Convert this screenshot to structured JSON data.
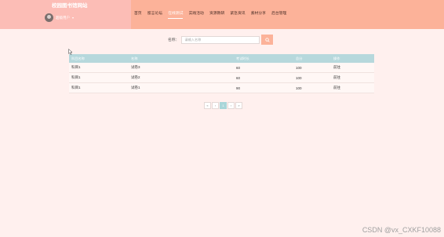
{
  "header": {
    "site_title": "校园图书馆网站",
    "username": "超级用户",
    "user_caret": "▾",
    "nav": [
      {
        "label": "首页"
      },
      {
        "label": "留言论坛"
      },
      {
        "label": "在线测试"
      },
      {
        "label": "实践活动"
      },
      {
        "label": "资源教研"
      },
      {
        "label": "紧急资讯"
      },
      {
        "label": "素材分享"
      },
      {
        "label": "后台管理"
      }
    ],
    "nav_active_index": 2
  },
  "search": {
    "label": "名称：",
    "placeholder": "请输入名称",
    "button_icon": "search-icon"
  },
  "table": {
    "headers": [
      "科目名称",
      "名称",
      "考试时长",
      "总分",
      "操作"
    ],
    "rows": [
      {
        "subject": "科目1",
        "name": "试卷3",
        "duration": "60",
        "score": "100",
        "action": "前往"
      },
      {
        "subject": "科目1",
        "name": "试卷2",
        "duration": "60",
        "score": "100",
        "action": "前往"
      },
      {
        "subject": "科目1",
        "name": "试卷1",
        "duration": "90",
        "score": "100",
        "action": "前往"
      }
    ]
  },
  "pagination": {
    "prev_first": "«",
    "prev": "‹",
    "current": "1",
    "next": "›",
    "next_last": "»"
  },
  "watermark": "CSDN @vx_CXKF10088",
  "colors": {
    "header_bg": "#fcb299",
    "brand_bg": "#fcbdb6",
    "page_bg": "#fff0ee",
    "table_header_bg": "#b6d8dc"
  }
}
